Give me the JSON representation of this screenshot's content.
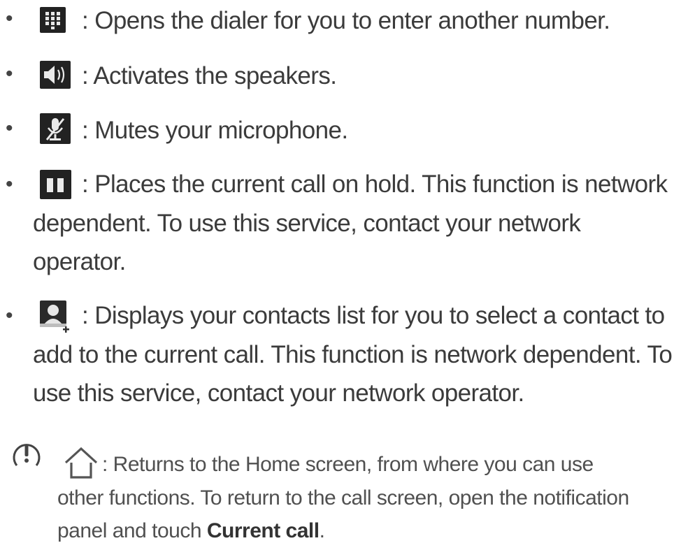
{
  "items": [
    {
      "icon": "dialpad-icon",
      "lines": [
        ": Opens the dialer for you to enter another number."
      ]
    },
    {
      "icon": "speaker-icon",
      "lines": [
        ": Activates the speakers."
      ]
    },
    {
      "icon": "microphone-mute-icon",
      "lines": [
        ": Mutes your microphone."
      ]
    },
    {
      "icon": "pause-icon",
      "lines": [
        ": Places the current call on hold. This function is network",
        "dependent. To use this service, contact your network",
        "operator."
      ]
    },
    {
      "icon": "add-contact-icon",
      "lines": [
        ": Displays your contacts list for you to select a contact to",
        "add to the current call. This function is network dependent. To",
        "use this service, contact your network operator."
      ]
    }
  ],
  "note": {
    "icon": "home-icon",
    "line1": ": Returns to the Home screen, from where you can use",
    "line2": "other functions. To return to the call screen, open the notification",
    "line3_prefix": "panel and touch ",
    "line3_bold": "Current call",
    "line3_suffix": "."
  }
}
